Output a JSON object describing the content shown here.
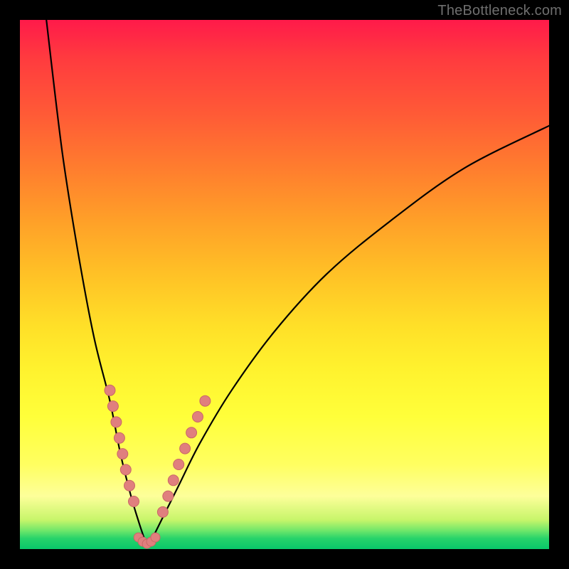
{
  "watermark": "TheBottleneck.com",
  "colors": {
    "background": "#000000",
    "gradient_top": "#ff1a4a",
    "gradient_bottom": "#09c86a",
    "curve_stroke": "#000000",
    "dot_fill": "#e07f7e",
    "dot_stroke": "#c96766"
  },
  "chart_data": {
    "type": "line",
    "title": "",
    "xlabel": "",
    "ylabel": "",
    "xlim": [
      0,
      100
    ],
    "ylim": [
      0,
      100
    ],
    "notes": "V-shaped bottleneck curve. Minimum (~0) near x≈24. Left branch rises steeply to ~100 at x≈5; right branch rises to ~80 at x≈100. Small pink dots cluster along both branches near the lower ~30% of the y-range, with a short flat run at the trough.",
    "series": [
      {
        "name": "left-branch",
        "x": [
          5,
          8,
          11,
          14,
          17,
          19,
          21,
          22.5,
          23.5,
          24
        ],
        "y": [
          100,
          75,
          56,
          40,
          28,
          18,
          10,
          5,
          2,
          0.5
        ]
      },
      {
        "name": "right-branch",
        "x": [
          24,
          25,
          27,
          30,
          34,
          40,
          48,
          58,
          70,
          84,
          100
        ],
        "y": [
          0.5,
          2,
          6,
          12,
          20,
          30,
          41,
          52,
          62,
          72,
          80
        ]
      }
    ],
    "dot_clusters": [
      {
        "branch": "left",
        "points": [
          [
            17.0,
            30
          ],
          [
            17.6,
            27
          ],
          [
            18.2,
            24
          ],
          [
            18.8,
            21
          ],
          [
            19.4,
            18
          ],
          [
            20.0,
            15
          ],
          [
            20.7,
            12
          ],
          [
            21.5,
            9
          ]
        ]
      },
      {
        "branch": "trough",
        "points": [
          [
            22.4,
            2.2
          ],
          [
            23.2,
            1.4
          ],
          [
            24.0,
            1.0
          ],
          [
            24.8,
            1.4
          ],
          [
            25.6,
            2.2
          ]
        ]
      },
      {
        "branch": "right",
        "points": [
          [
            27.0,
            7
          ],
          [
            28.0,
            10
          ],
          [
            29.0,
            13
          ],
          [
            30.0,
            16
          ],
          [
            31.2,
            19
          ],
          [
            32.4,
            22
          ],
          [
            33.6,
            25
          ],
          [
            35.0,
            28
          ]
        ]
      }
    ]
  }
}
